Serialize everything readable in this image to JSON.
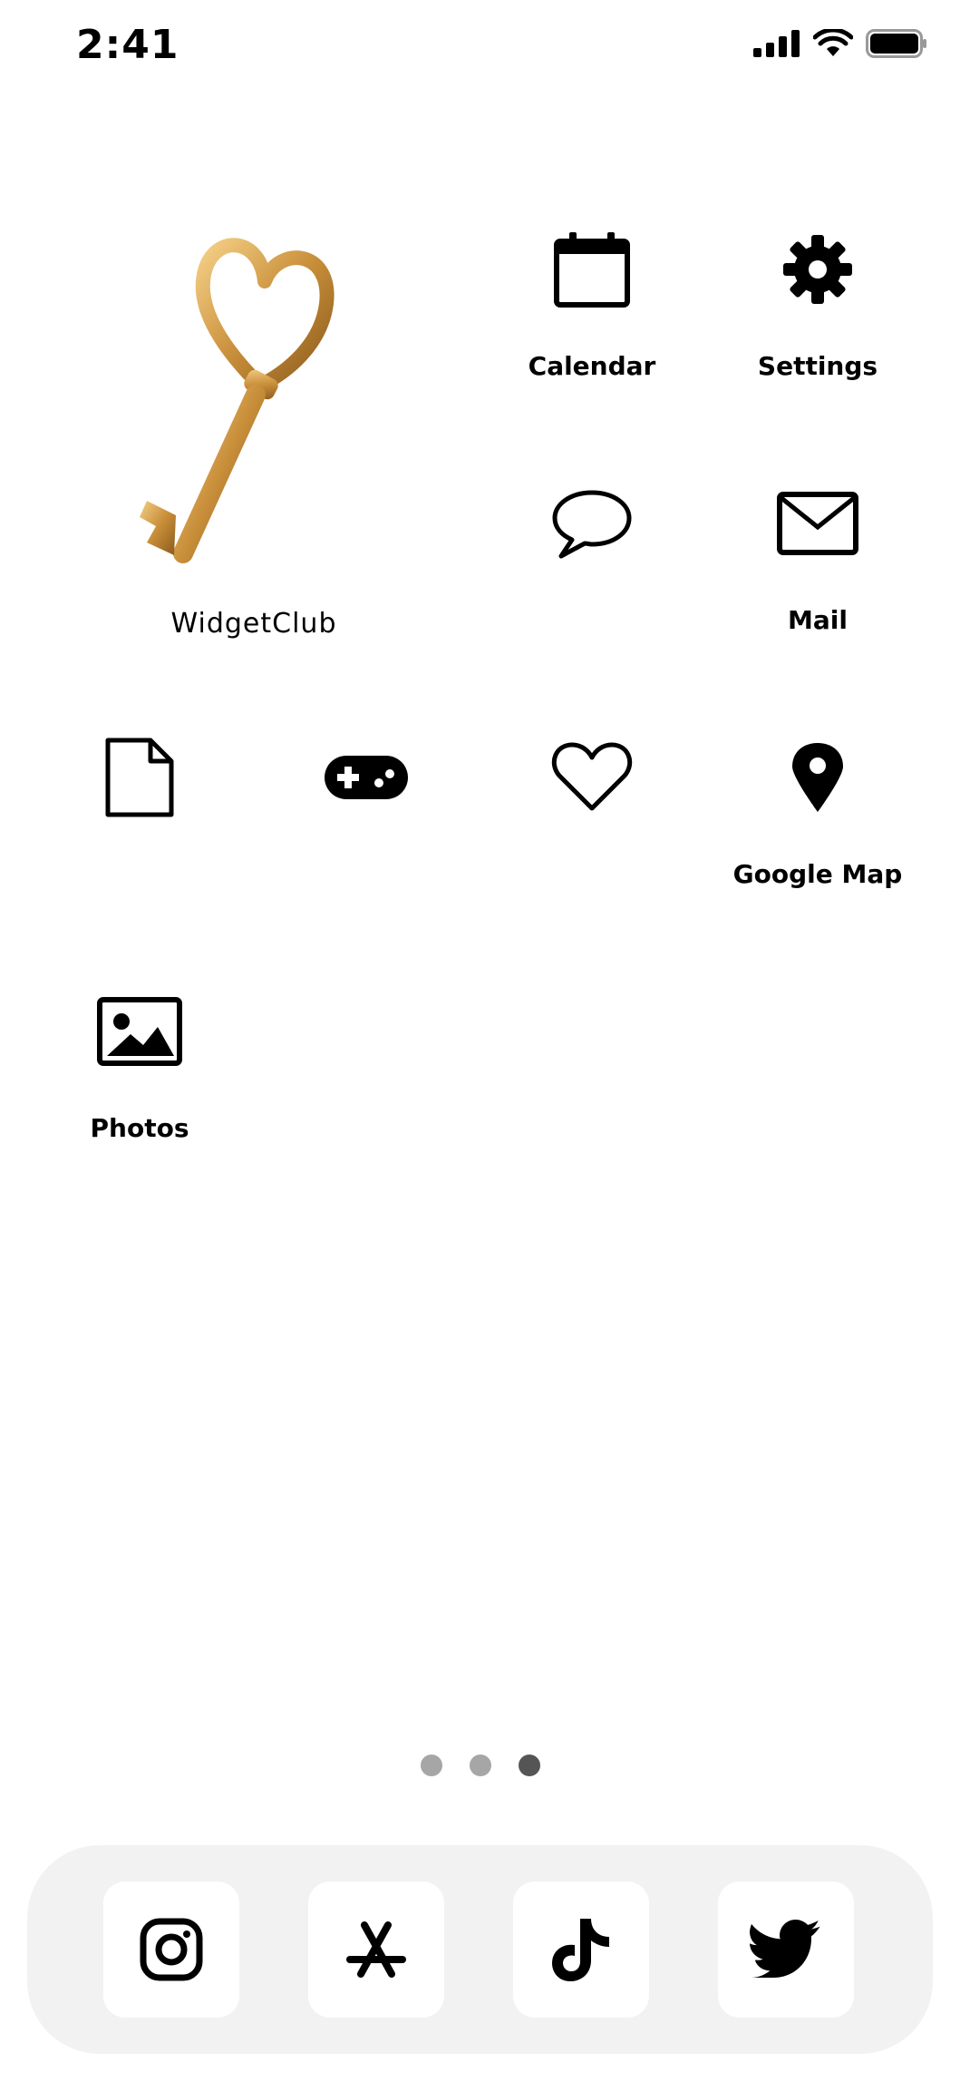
{
  "status_bar": {
    "time": "2:41"
  },
  "widget": {
    "label": "WidgetClub"
  },
  "apps": {
    "calendar": "Calendar",
    "settings": "Settings",
    "messages": "",
    "mail": "Mail",
    "files": "",
    "games": "",
    "health": "",
    "google_map": "Google Map",
    "photos": "Photos"
  },
  "page_dots": {
    "count": 3,
    "active": 3
  },
  "dock": [
    "instagram-icon",
    "app-store-icon",
    "tiktok-icon",
    "twitter-icon"
  ],
  "colors": {
    "background": "#ffffff",
    "dock": "#f2f2f2",
    "key_gold": "#c98f3a",
    "dot_inactive": "#a6a6a6",
    "dot_active": "#555555"
  }
}
